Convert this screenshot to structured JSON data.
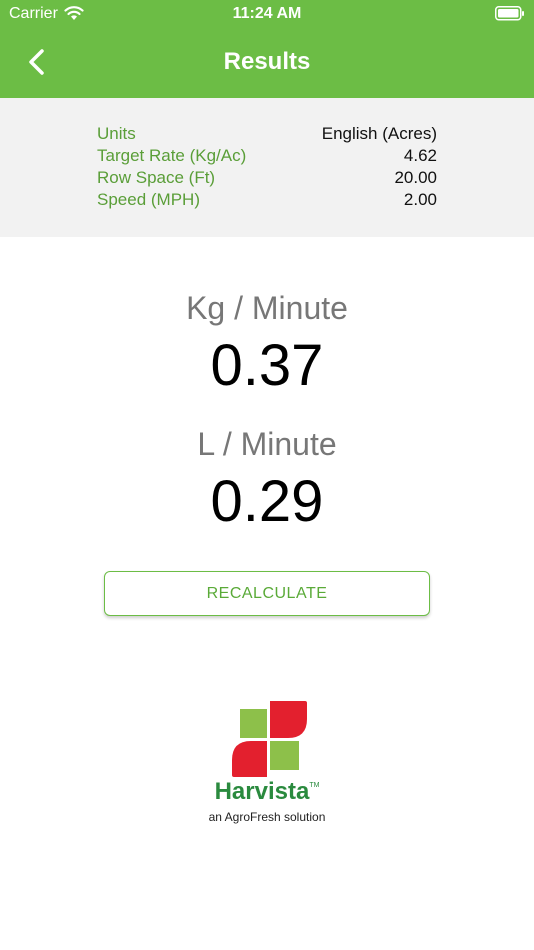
{
  "status_bar": {
    "carrier": "Carrier",
    "time": "11:24 AM"
  },
  "header": {
    "title": "Results",
    "back_icon": "chevron-left-icon"
  },
  "summary": {
    "rows": [
      {
        "label": "Units",
        "value": "English (Acres)"
      },
      {
        "label": "Target Rate (Kg/Ac)",
        "value": "4.62"
      },
      {
        "label": "Row Space (Ft)",
        "value": "20.00"
      },
      {
        "label": "Speed (MPH)",
        "value": "2.00"
      }
    ]
  },
  "results": {
    "kg_label": "Kg / Minute",
    "kg_value": "0.37",
    "l_label": "L / Minute",
    "l_value": "0.29"
  },
  "actions": {
    "recalculate": "RECALCULATE"
  },
  "logo": {
    "brand": "Harvista",
    "trademark": "TM",
    "tagline": "an AgroFresh solution"
  },
  "colors": {
    "primary_green": "#6cbd45",
    "label_green": "#5a9e38",
    "logo_red": "#e3202e",
    "logo_green": "#8dc04a",
    "brand_green": "#2a8a3e"
  }
}
